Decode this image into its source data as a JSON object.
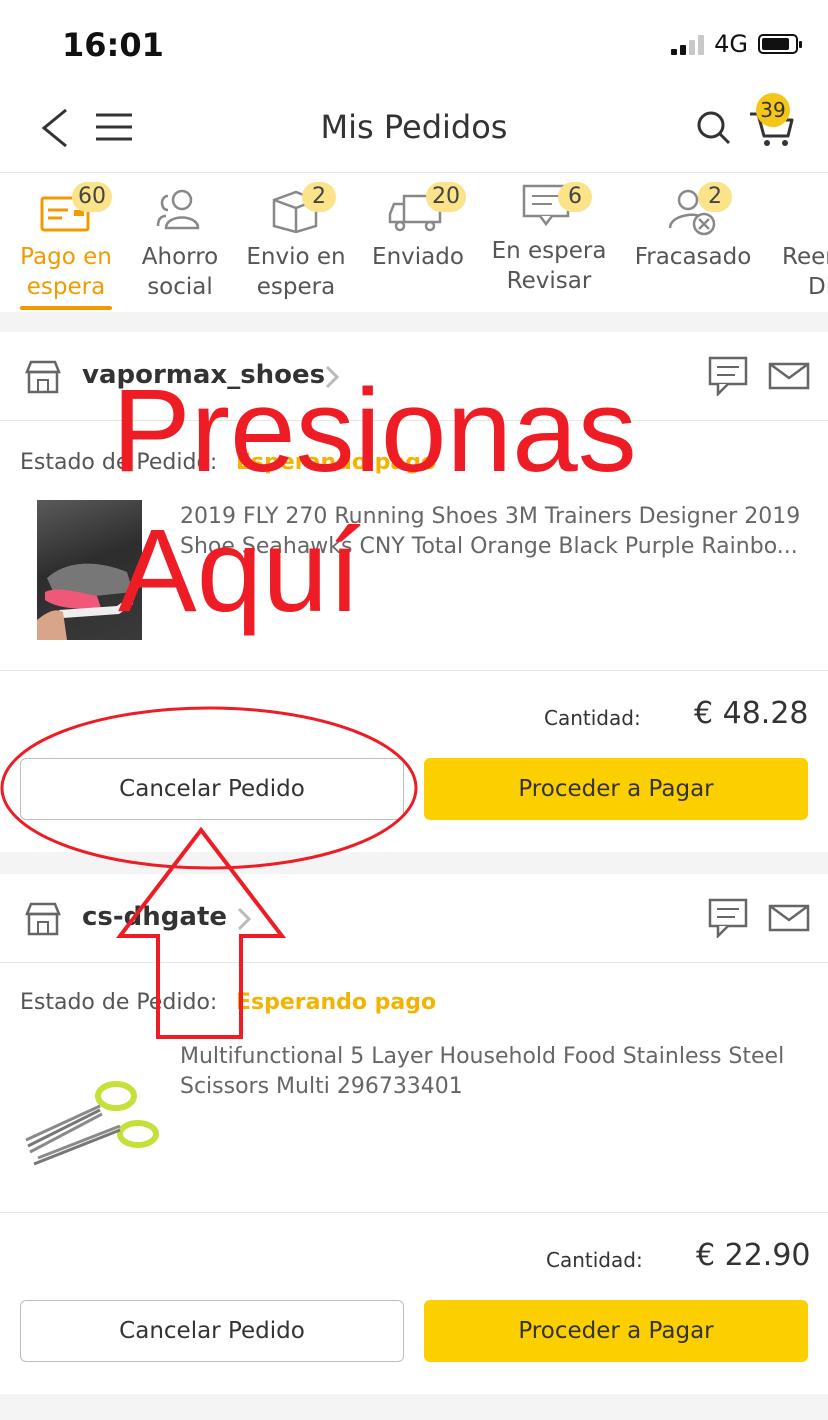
{
  "status_bar": {
    "time": "16:01",
    "network": "4G"
  },
  "header": {
    "title": "Mis Pedidos",
    "cart_count": "39"
  },
  "tabs": [
    {
      "label_line1": "Pago en",
      "label_line2": "espera",
      "badge": "60",
      "icon": "card-icon",
      "active": true
    },
    {
      "label_line1": "Ahorro",
      "label_line2": "social",
      "badge": "",
      "icon": "group-icon"
    },
    {
      "label_line1": "Envio en",
      "label_line2": "espera",
      "badge": "2",
      "icon": "box-icon"
    },
    {
      "label_line1": "Enviado",
      "label_line2": "",
      "badge": "20",
      "icon": "truck-icon"
    },
    {
      "label_line1": "En espera",
      "label_line2": "Revisar",
      "badge": "6",
      "icon": "review-icon"
    },
    {
      "label_line1": "Fracasado",
      "label_line2": "",
      "badge": "2",
      "icon": "failed-icon"
    },
    {
      "label_line1": "Reem",
      "label_line2": "Di",
      "badge": "",
      "icon": ""
    }
  ],
  "orders": [
    {
      "store": "vapormax_shoes",
      "status_label": "Estado de Pedido:",
      "status_value": "Esperando pago",
      "product_line1": "2019 FLY 270 Running Shoes 3M Trainers Designer 2019",
      "product_line2": "Shoe Seahawks CNY Total Orange Black Purple Rainbo...",
      "qty_label": "Cantidad:",
      "price": "€ 48.28",
      "cancel_label": "Cancelar Pedido",
      "pay_label": "Proceder a Pagar"
    },
    {
      "store": "cs-dhgate",
      "status_label": "Estado de Pedido:",
      "status_value": "Esperando pago",
      "product_line1": "Multifunctional 5 Layer Household Food Stainless Steel",
      "product_line2": "Scissors Multi 296733401",
      "qty_label": "Cantidad:",
      "price": "€ 22.90",
      "cancel_label": "Cancelar Pedido",
      "pay_label": "Proceder a Pagar"
    }
  ],
  "annotation": {
    "line1": "Presionas",
    "line2": "Aquí",
    "color": "#ee1c25"
  },
  "colors": {
    "accent": "#f29a00",
    "status": "#f2b400",
    "pay_button": "#fccf00",
    "badge": "#fbe38a"
  }
}
